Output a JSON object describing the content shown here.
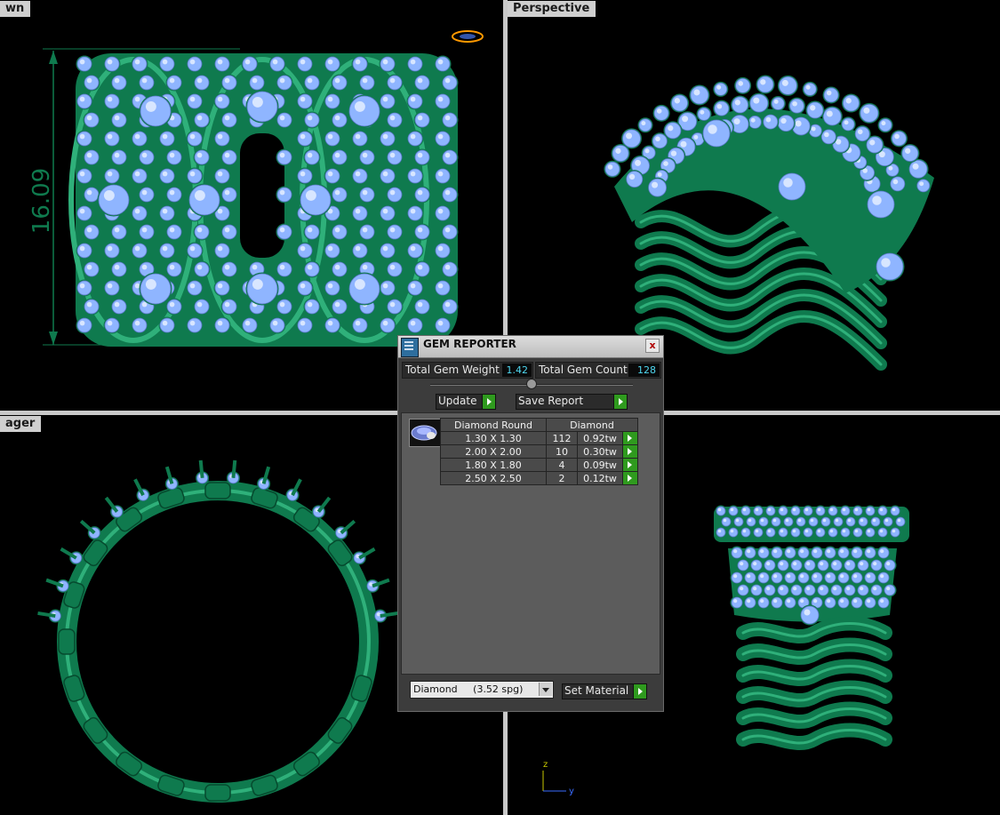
{
  "viewports": {
    "top_left": {
      "label": "wn",
      "dimension_text": "16.09"
    },
    "top_right": {
      "label": "Perspective"
    },
    "bottom_left": {
      "label": "ager"
    },
    "bottom_right": {
      "label": "",
      "axis_z": "z",
      "axis_y": "y"
    }
  },
  "gem_reporter": {
    "title": "GEM REPORTER",
    "close_glyph": "x",
    "total_weight_label": "Total Gem Weight",
    "total_weight_value": "1.42",
    "total_count_label": "Total Gem Count",
    "total_count_value": "128",
    "update_label": "Update",
    "save_report_label": "Save Report",
    "table_header": {
      "shape": "Diamond Round",
      "material": "Diamond"
    },
    "rows": [
      {
        "size": "1.30 X 1.30",
        "count": "112",
        "weight": "0.92tw"
      },
      {
        "size": "2.00 X 2.00",
        "count": "10",
        "weight": "0.30tw"
      },
      {
        "size": "1.80 X 1.80",
        "count": "4",
        "weight": "0.09tw"
      },
      {
        "size": "2.50 X 2.50",
        "count": "2",
        "weight": "0.12tw"
      }
    ],
    "material_select_value": "Diamond     (3.52 spg)",
    "set_material_label": "Set Material"
  },
  "colors": {
    "metal": "#0f7a4e",
    "metal_highlight": "#2fb07a",
    "gem": "#8fb5ff",
    "gem_dark": "#5a78c8",
    "value_text": "#4fd7f0",
    "go_button": "#2f9a1e"
  }
}
